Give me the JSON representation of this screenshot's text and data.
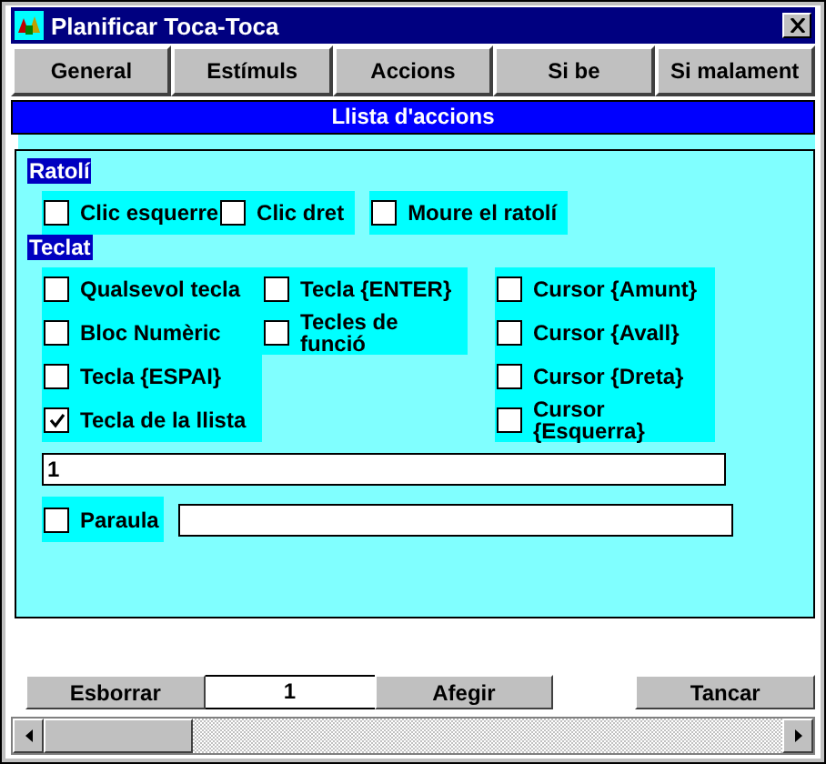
{
  "window": {
    "title": "Planificar Toca-Toca"
  },
  "tabs": [
    {
      "label": "General"
    },
    {
      "label": "Estímuls"
    },
    {
      "label": "Accions"
    },
    {
      "label": "Si be"
    },
    {
      "label": "Si malament"
    }
  ],
  "header": "Llista d'accions",
  "mouse": {
    "title": "Ratolí",
    "groups": [
      [
        {
          "label": "Clic esquerre",
          "checked": false
        },
        {
          "label": "Clic dret",
          "checked": false
        }
      ],
      [
        {
          "label": "Moure el ratolí",
          "checked": false
        }
      ]
    ]
  },
  "keyboard": {
    "title": "Teclat",
    "columns": [
      [
        {
          "label": "Qualsevol tecla",
          "checked": false
        },
        {
          "label": "Bloc Numèric",
          "checked": false
        },
        {
          "label": "Tecla {ESPAI}",
          "checked": false
        },
        {
          "label": "Tecla de la llista",
          "checked": true
        }
      ],
      [
        {
          "label": "Tecla {ENTER}",
          "checked": false
        },
        {
          "label": "Tecles de funció",
          "checked": false
        }
      ],
      [
        {
          "label": "Cursor {Amunt}",
          "checked": false
        },
        {
          "label": "Cursor {Avall}",
          "checked": false
        },
        {
          "label": "Cursor {Dreta}",
          "checked": false
        },
        {
          "label": "Cursor {Esquerra}",
          "checked": false
        }
      ]
    ]
  },
  "key_list_field": {
    "value": "1"
  },
  "word": {
    "label": "Paraula",
    "checked": false
  },
  "bottom_bar": {
    "delete_button": "Esborrar",
    "counter": "1",
    "add_button": "Afegir",
    "close_button": "Tancar"
  }
}
